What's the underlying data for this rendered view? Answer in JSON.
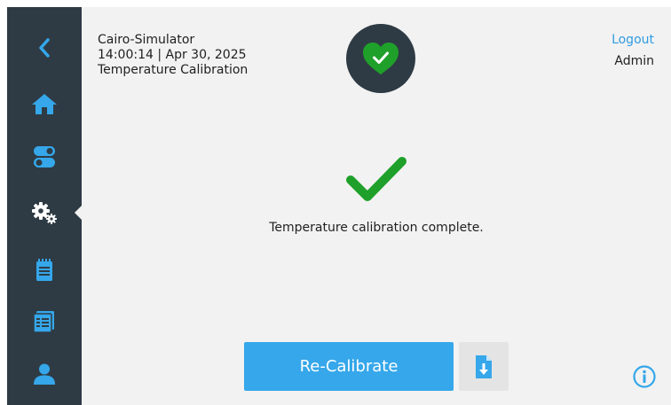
{
  "header": {
    "app_name": "Cairo-Simulator",
    "datetime": "14:00:14 | Apr 30, 2025",
    "page_title": "Temperature Calibration"
  },
  "status": {
    "icon": "heart-check-icon",
    "color": "#1fa02a"
  },
  "user": {
    "logout_label": "Logout",
    "name": "Admin"
  },
  "sidebar": {
    "items": [
      {
        "name": "back",
        "icon": "chevron-left-icon",
        "color": "#35a7ea"
      },
      {
        "name": "home",
        "icon": "home-icon",
        "color": "#35a7ea"
      },
      {
        "name": "toggles",
        "icon": "toggle-icon",
        "color": "#35a7ea"
      },
      {
        "name": "settings",
        "icon": "gears-icon",
        "color": "#ffffff",
        "active": true
      },
      {
        "name": "notes",
        "icon": "notepad-icon",
        "color": "#35a7ea"
      },
      {
        "name": "logs",
        "icon": "list-icon",
        "color": "#35a7ea"
      },
      {
        "name": "users",
        "icon": "user-icon",
        "color": "#35a7ea"
      }
    ]
  },
  "main": {
    "result_icon": "checkmark-icon",
    "message": "Temperature calibration complete.",
    "recalibrate_label": "Re-Calibrate",
    "export_icon": "file-download-icon",
    "info_icon": "info-icon"
  },
  "colors": {
    "accent": "#35a7ea",
    "success": "#1fa02a",
    "sidebar_bg": "#2e3b45",
    "background": "#f2f2f2"
  }
}
